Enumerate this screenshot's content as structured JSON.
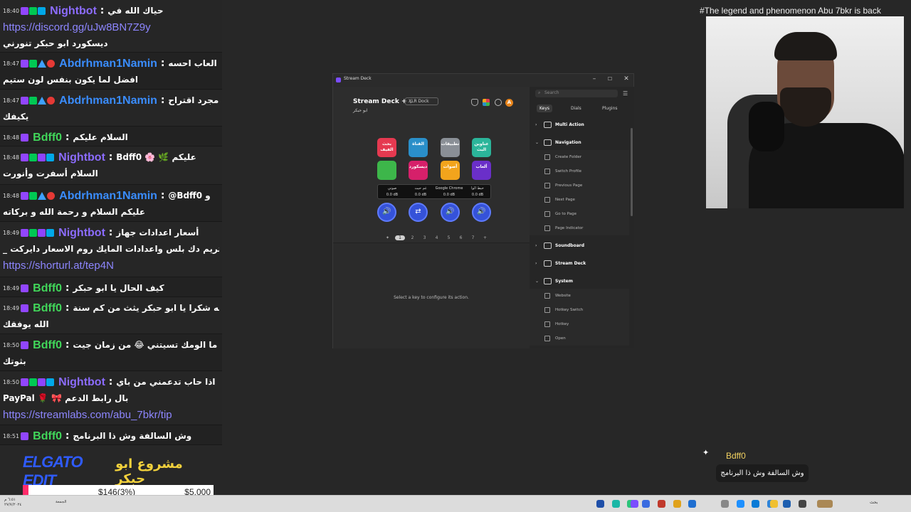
{
  "chat": {
    "messages": [
      {
        "time": "18:40",
        "badges": [
          "purple",
          "green",
          "blue"
        ],
        "user": "Nightbot",
        "user_color": "purple",
        "line1": "حياك الله في",
        "link": "https://discord.gg/uJw8BN7Z9y",
        "line2": "ديسكورد ابو حبكر تنورني"
      },
      {
        "time": "18:47",
        "badges": [
          "purple",
          "green",
          "tri",
          "red"
        ],
        "user": "Abdrhman1Namin",
        "user_color": "blue",
        "line1": "العاب احسه",
        "line2": "افضل لما يكون بنفس لون ستيم"
      },
      {
        "time": "18:47",
        "badges": [
          "purple",
          "green",
          "tri",
          "red"
        ],
        "user": "Abdrhman1Namin",
        "user_color": "blue",
        "line1": "مجرد اقتراح",
        "line2": "يكيفك"
      },
      {
        "time": "18:48",
        "badges": [
          "purple"
        ],
        "user": "Bdff0",
        "user_color": "green",
        "line1": "السلام عليكم"
      },
      {
        "time": "18:48",
        "badges": [
          "purple",
          "green",
          "star",
          "blue"
        ],
        "user": "Nightbot",
        "user_color": "purple",
        "line1": "Bdff0  🌸 🌿  عليكم",
        "line2": "السلام أسفرت وأنورت"
      },
      {
        "time": "18:48",
        "badges": [
          "purple",
          "green",
          "tri",
          "red"
        ],
        "user": "Abdrhman1Namin",
        "user_color": "blue",
        "line1": "@Bdff0 و",
        "line2": "عليكم السلام و رحمة الله و بركاته"
      },
      {
        "time": "18:49",
        "badges": [
          "purple",
          "green",
          "star",
          "blue"
        ],
        "user": "Nightbot",
        "user_color": "purple",
        "line1": "أسعار اعدادات جهاز",
        "line2": "_ ستريم دك بلس واعدادات المايك روم الاسعار دايركت",
        "link": "https://shorturl.at/tep4N"
      },
      {
        "time": "18:49",
        "badges": [
          "purple"
        ],
        "user": "Bdff0",
        "user_color": "green",
        "line1": "كيف الحال يا ابو حبكر"
      },
      {
        "time": "18:49",
        "badges": [
          "purple"
        ],
        "user": "Bdff0",
        "user_color": "green",
        "line1": "والله شكرا يا ابو حبكر يثث من كم سنة",
        "line2": "الله يوفقك"
      },
      {
        "time": "18:50",
        "badges": [
          "purple"
        ],
        "user": "Bdff0",
        "user_color": "green",
        "line1": "والله ما الومك تسيتني 😂 من زمان جيت",
        "line2": "بثوتك"
      },
      {
        "time": "18:50",
        "badges": [
          "purple",
          "green",
          "star",
          "blue"
        ],
        "user": "Nightbot",
        "user_color": "purple",
        "line1": "اذا حاب تدعمني من باي",
        "line2": "PayPal  🌹 🎀  بال رابط الدعم",
        "link": "https://streamlabs.com/abu_7bkr/tip"
      },
      {
        "time": "18:51",
        "badges": [
          "purple"
        ],
        "user": "Bdff0",
        "user_color": "green",
        "line1": "وش السالفة وش ذا البرنامج"
      }
    ]
  },
  "donation": {
    "brand": "ELGATO EDIT",
    "title": "مشروع ابو حبكر",
    "raised": "$146(3%)",
    "goal": "$5,000",
    "progress_fraction": 0.03,
    "fill_color": "#ff2b6a"
  },
  "webcam": {
    "title": "#The legend and phenomenon Abu 7bkr is back"
  },
  "stream_deck": {
    "window_title": "Stream Deck",
    "profile": "Stream Deck +",
    "profile_sub": "ابو حبكر",
    "device": "XLR Dock",
    "keys": [
      {
        "label": "بحث الفيف",
        "color": "#e53950"
      },
      {
        "label": "القناة",
        "color": "#2a8fc9"
      },
      {
        "label": "تطبيقات",
        "color": "#8a8f96"
      },
      {
        "label": "عناوين البث",
        "color": "#2bb59a"
      },
      {
        "label": "",
        "color": "#3db64a"
      },
      {
        "label": "ديسكورد",
        "color": "#d6206a"
      },
      {
        "label": "أصوات",
        "color": "#f2a41c"
      },
      {
        "label": "ألعاب",
        "color": "#6a2fc9"
      }
    ],
    "strip": [
      {
        "title": "صوتي",
        "value": "0.0 dB"
      },
      {
        "title": "غم حيث",
        "value": "0.0 dB"
      },
      {
        "title": "Google Chrome",
        "value": "0.0 dB"
      },
      {
        "title": "خيط الوا",
        "value": "0.0 dB"
      }
    ],
    "dials": [
      "🔊",
      "⇄",
      "🔊",
      "🔊"
    ],
    "pages": [
      "1",
      "2",
      "3",
      "4",
      "5",
      "6",
      "7"
    ],
    "hint": "Select a key to configure its action.",
    "search_placeholder": "Search",
    "tabs": {
      "keys": "Keys",
      "dials": "Dials",
      "plugins": "Plugins"
    },
    "categories": {
      "multi_action": "Multi Action",
      "navigation": "Navigation",
      "soundboard": "Soundboard",
      "stream_deck": "Stream Deck",
      "system": "System"
    },
    "nav_items": [
      "Create Folder",
      "Switch Profile",
      "Previous Page",
      "Next Page",
      "Go to Page",
      "Page Indicator"
    ],
    "system_items": [
      "Website",
      "Hotkey Switch",
      "Hotkey",
      "Open"
    ]
  },
  "popup": {
    "user": "Bdff0",
    "text": "وش السالفة وش ذا البرنامج"
  },
  "taskbar": {
    "time": "٦:٥١ م",
    "date": "٢٧/٧/٢٠٢٤",
    "widget": "الجمعة",
    "lang": "بحث"
  }
}
